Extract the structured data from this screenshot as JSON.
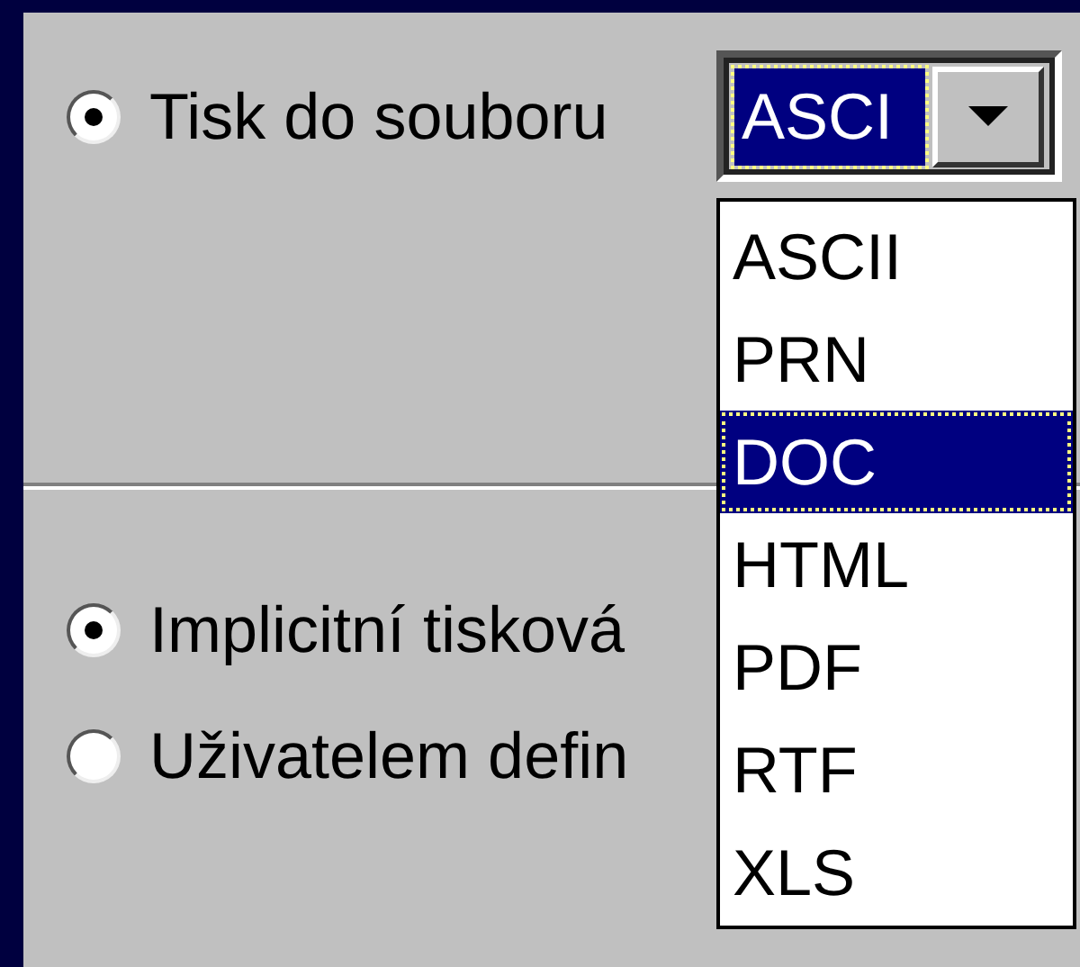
{
  "file_option": {
    "label": "Tisk do souboru",
    "selected": true,
    "format_combo": {
      "value": "ASCI",
      "open": true,
      "options": [
        {
          "label": "ASCII",
          "selected": false
        },
        {
          "label": "PRN",
          "selected": false
        },
        {
          "label": "DOC",
          "selected": true
        },
        {
          "label": "HTML",
          "selected": false
        },
        {
          "label": "PDF",
          "selected": false
        },
        {
          "label": "RTF",
          "selected": false
        },
        {
          "label": "XLS",
          "selected": false
        }
      ]
    }
  },
  "printer_options": [
    {
      "label": "Implicitní tisková",
      "selected": true
    },
    {
      "label": "Uživatelem defin",
      "selected": false
    }
  ]
}
